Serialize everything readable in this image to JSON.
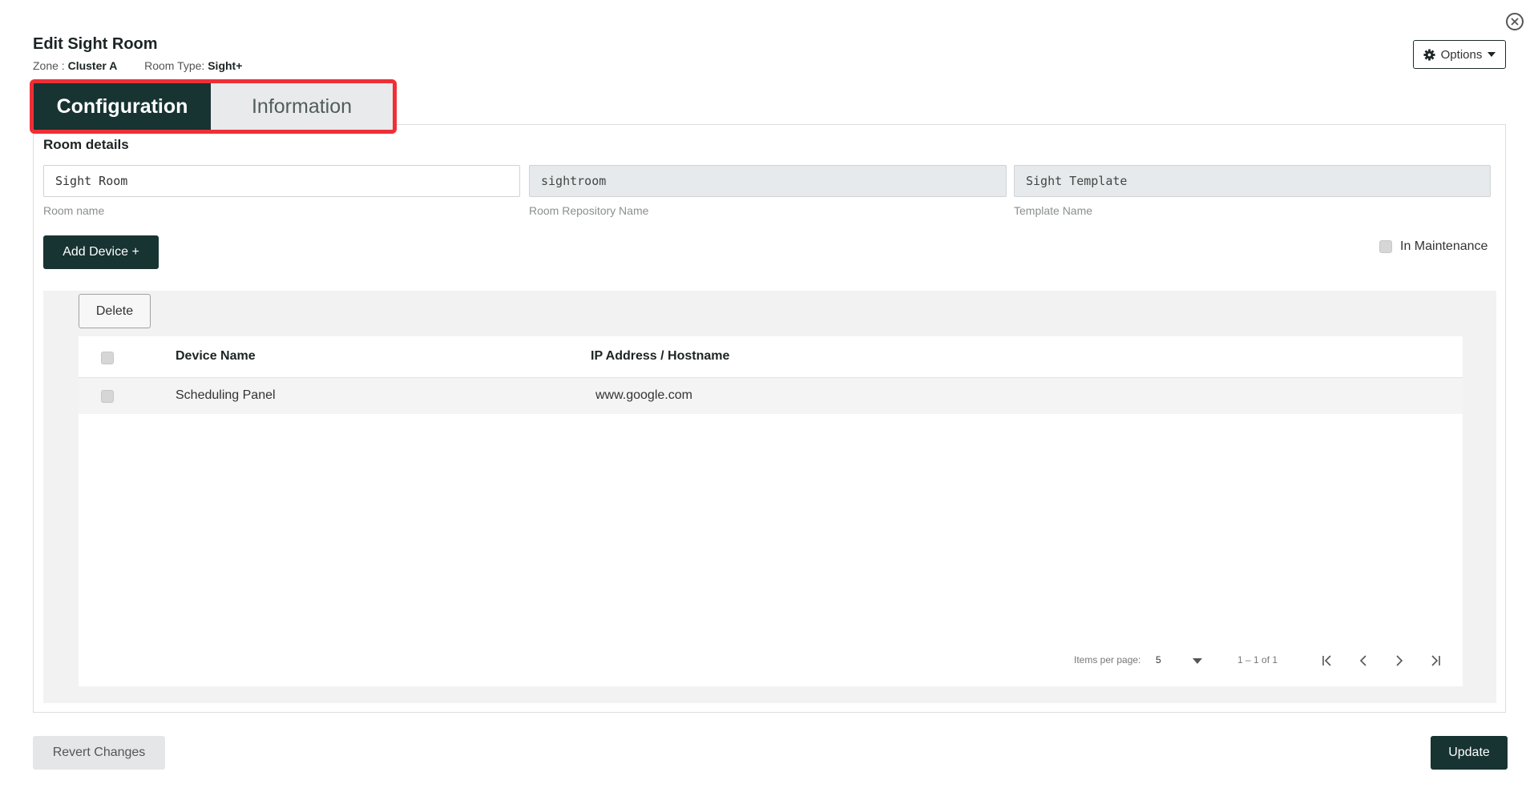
{
  "dialog": {
    "title": "Edit Sight Room",
    "zone_label": "Zone :",
    "zone_value": "Cluster A",
    "room_type_label": "Room Type:",
    "room_type_value": "Sight+",
    "options_label": "Options"
  },
  "tabs": [
    {
      "label": "Configuration",
      "active": true
    },
    {
      "label": "Information",
      "active": false
    }
  ],
  "room_details": {
    "heading": "Room details",
    "fields": [
      {
        "value": "Sight Room",
        "label": "Room name",
        "readonly": false
      },
      {
        "value": "sightroom",
        "label": "Room Repository Name",
        "readonly": true
      },
      {
        "value": "Sight Template",
        "label": "Template Name",
        "readonly": true
      }
    ],
    "add_device_label": "Add Device +",
    "maintenance_label": "In Maintenance"
  },
  "devices": {
    "delete_label": "Delete",
    "columns": [
      "Device Name",
      "IP Address / Hostname"
    ],
    "rows": [
      {
        "name": "Scheduling Panel",
        "host": "www.google.com"
      }
    ],
    "pager": {
      "items_per_page_label": "Items per page:",
      "items_per_page_value": "5",
      "range": "1 – 1 of 1"
    }
  },
  "footer": {
    "revert_label": "Revert Changes",
    "update_label": "Update"
  },
  "colors": {
    "accent": "#173332",
    "highlight": "#ee2f36"
  },
  "icons": [
    "close-icon",
    "gear-icon",
    "caret-down-icon",
    "first-page-icon",
    "prev-page-icon",
    "next-page-icon",
    "last-page-icon"
  ]
}
